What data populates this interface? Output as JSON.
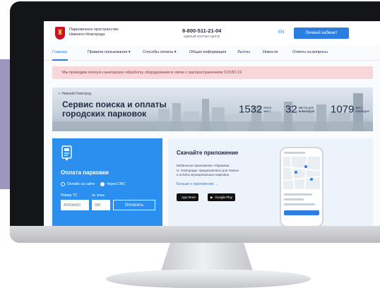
{
  "header": {
    "brand_line1": "Парковочное пространство",
    "brand_line2": "Нижнего Новгорода",
    "phone": "8-800-511-21-04",
    "phone_caption": "единый контакт-центр",
    "lang": "EN",
    "cabinet_button": "Личный кабинет"
  },
  "nav": {
    "items": [
      {
        "label": "Главная",
        "active": true
      },
      {
        "label": "Правила пользования ▾"
      },
      {
        "label": "Способы оплаты ▾"
      },
      {
        "label": "Общая информация"
      },
      {
        "label": "Льготы"
      },
      {
        "label": "Новости"
      },
      {
        "label": "Ответы на вопросы"
      }
    ]
  },
  "alert": {
    "text": "Мы проводим полную санитарную обработку оборудования в связи с распространением COVID-19"
  },
  "hero": {
    "breadcrumb": "Нижний Новгород",
    "title": "Сервис поиска и оплаты городских парковок",
    "stats": [
      {
        "value": "1532",
        "label_line1": "всего",
        "label_line2": "мест"
      },
      {
        "value": "32",
        "label_line1": "места для",
        "label_line2": "инвалидов"
      },
      {
        "value": "1079",
        "label_line1": "мест",
        "label_line2": "свободно"
      }
    ]
  },
  "payment": {
    "title": "Оплата парковки",
    "option_online": "Онлайн на сайте",
    "option_sms": "Через СМС",
    "selected_option": "Через СМС",
    "plate_label": "Номер ТС",
    "zone_label": "№ зоны",
    "plate_placeholder": "А000АА00",
    "zone_placeholder": "000",
    "pay_button": "Оплатить"
  },
  "app_promo": {
    "title": "Скачайте приложение",
    "description_line1": "Мобильное приложение «Парковки",
    "description_line2": "Н. Новгорода» предназначено для поиска",
    "description_line3": "и оплаты муниципальных парковок.",
    "more_link": "Больше о приложении →",
    "app_store": "App Store",
    "google_play": "Google Play"
  },
  "colors": {
    "accent": "#2b7de1",
    "payment_card": "#2b8fef",
    "alert_bg": "#f8d7da",
    "alert_text": "#9a2c34",
    "monitor_bezel": "#141518",
    "side_panel": "#9e97bd"
  }
}
